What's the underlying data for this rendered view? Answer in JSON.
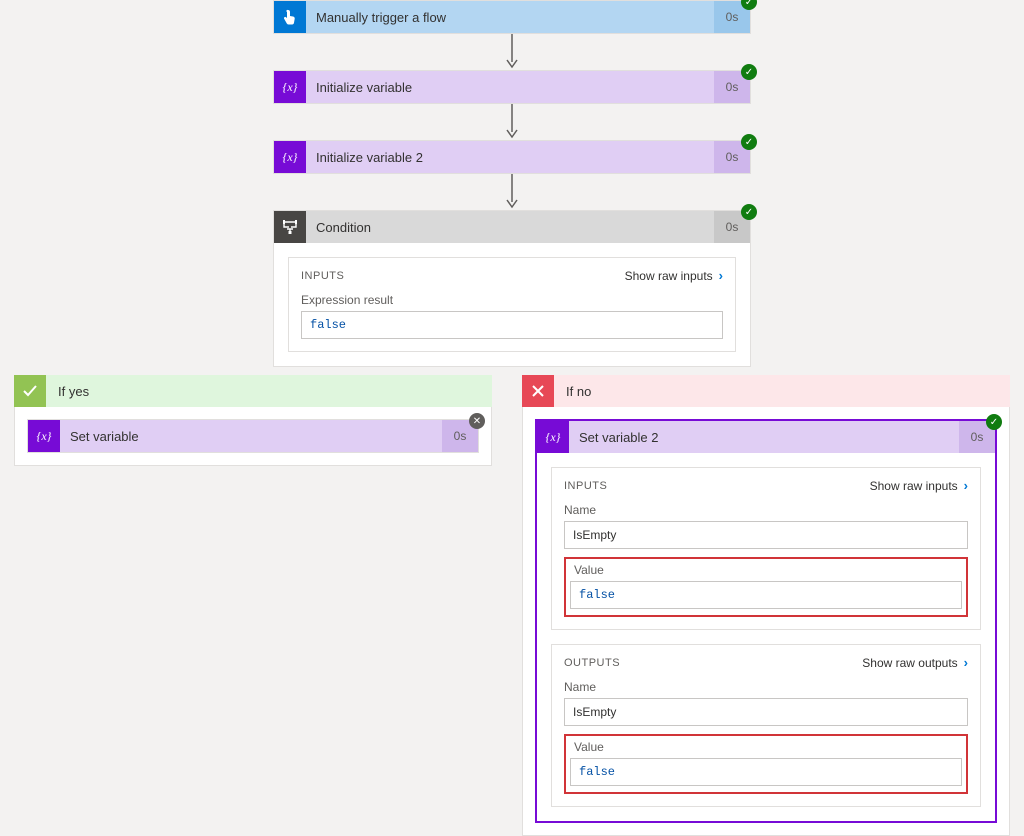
{
  "trigger": {
    "title": "Manually trigger a flow",
    "duration": "0s",
    "status": "success"
  },
  "init_var": {
    "title": "Initialize variable",
    "duration": "0s",
    "status": "success"
  },
  "init_var2": {
    "title": "Initialize variable 2",
    "duration": "0s",
    "status": "success"
  },
  "condition": {
    "title": "Condition",
    "duration": "0s",
    "status": "success",
    "inputs_label": "INPUTS",
    "show_raw_inputs": "Show raw inputs",
    "expression_label": "Expression result",
    "expression_value": "false"
  },
  "branches": {
    "yes": {
      "label": "If yes",
      "action": {
        "title": "Set variable",
        "duration": "0s",
        "status": "skipped"
      }
    },
    "no": {
      "label": "If no",
      "action": {
        "title": "Set variable 2",
        "duration": "0s",
        "status": "success",
        "inputs": {
          "label": "INPUTS",
          "show_raw": "Show raw inputs",
          "name_label": "Name",
          "name_value": "IsEmpty",
          "value_label": "Value",
          "value_value": "false"
        },
        "outputs": {
          "label": "OUTPUTS",
          "show_raw": "Show raw outputs",
          "name_label": "Name",
          "name_value": "IsEmpty",
          "value_label": "Value",
          "value_value": "false"
        }
      }
    }
  }
}
